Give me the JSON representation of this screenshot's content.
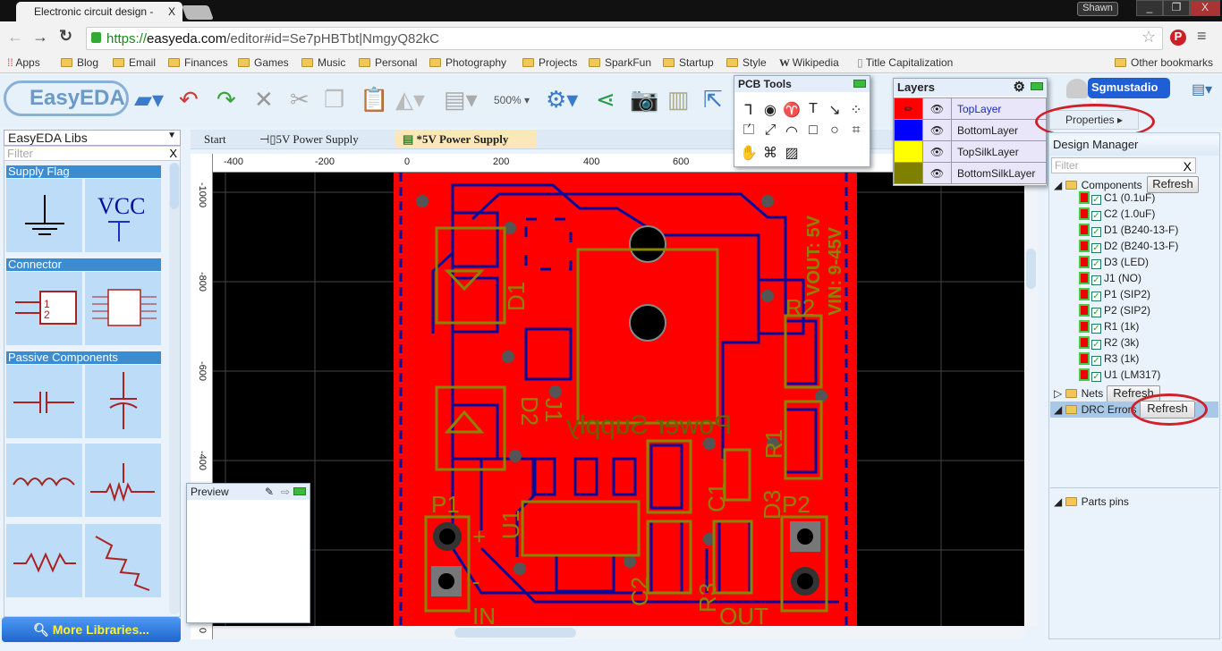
{
  "browser": {
    "tab_title": "Electronic circuit design -",
    "tab_close": "X",
    "user": "Shawn",
    "url_scheme": "https://",
    "url_host": "easyeda.com",
    "url_path": "/editor#id=Se7pHBTbt|NmgyQ82kC",
    "bookmarks": [
      "Apps",
      "Blog",
      "Email",
      "Finances",
      "Games",
      "Music",
      "Personal",
      "Photography",
      "Projects",
      "SparkFun",
      "Startup",
      "Style",
      "Wikipedia",
      "Title Capitalization"
    ],
    "other_bookmarks": "Other bookmarks"
  },
  "toolbar": {
    "logo": "EasyEDA",
    "zoom": "500%"
  },
  "libs": {
    "selected": "EasyEDA Libs",
    "filter_placeholder": "Filter",
    "categories": [
      "Supply Flag",
      "Connector",
      "Passive Components"
    ],
    "vcc": "VCC",
    "more": "More Libraries..."
  },
  "doc_tabs": [
    "Start",
    "5V Power Supply",
    "*5V Power Supply"
  ],
  "ruler": {
    "x": [
      "-400",
      "-200",
      "0",
      "200",
      "400",
      "600"
    ],
    "y": [
      "-1000",
      "-800",
      "-600",
      "-400",
      "0"
    ]
  },
  "pcb": {
    "silk": [
      "D1",
      "D2",
      "J1",
      "U1",
      "C1",
      "C2",
      "R1",
      "R2",
      "R3",
      "D3",
      "P1",
      "P2",
      "IN",
      "OUT",
      "VOUT: 5V",
      "VIN: 9-45V",
      "Power Supply",
      "+",
      "-"
    ],
    "colors": {
      "board": "#ff0000",
      "bottom": "#0000a0",
      "silk": "#8c8400"
    }
  },
  "pcb_tools": {
    "title": "PCB Tools"
  },
  "layers": {
    "title": "Layers",
    "items": [
      {
        "name": "TopLayer",
        "color": "#ff0000",
        "active": true
      },
      {
        "name": "BottomLayer",
        "color": "#0000ff"
      },
      {
        "name": "TopSilkLayer",
        "color": "#ffff00"
      },
      {
        "name": "BottomSilkLayer",
        "color": "#808000"
      }
    ]
  },
  "preview": {
    "title": "Preview"
  },
  "user_menu": {
    "name": "Sgmustadio"
  },
  "right": {
    "properties": "Properties",
    "design_manager": "Design Manager",
    "filter_placeholder": "Filter",
    "components_label": "Components",
    "refresh": "Refresh",
    "components": [
      "C1 (0.1uF)",
      "C2 (1.0uF)",
      "D1 (B240-13-F)",
      "D2 (B240-13-F)",
      "D3 (LED)",
      "J1 (NO)",
      "P1 (SIP2)",
      "P2 (SIP2)",
      "R1 (1k)",
      "R2 (3k)",
      "R3 (1k)",
      "U1 (LM317)"
    ],
    "nets": "Nets",
    "drc": "DRC Errors",
    "parts_pins": "Parts pins"
  }
}
